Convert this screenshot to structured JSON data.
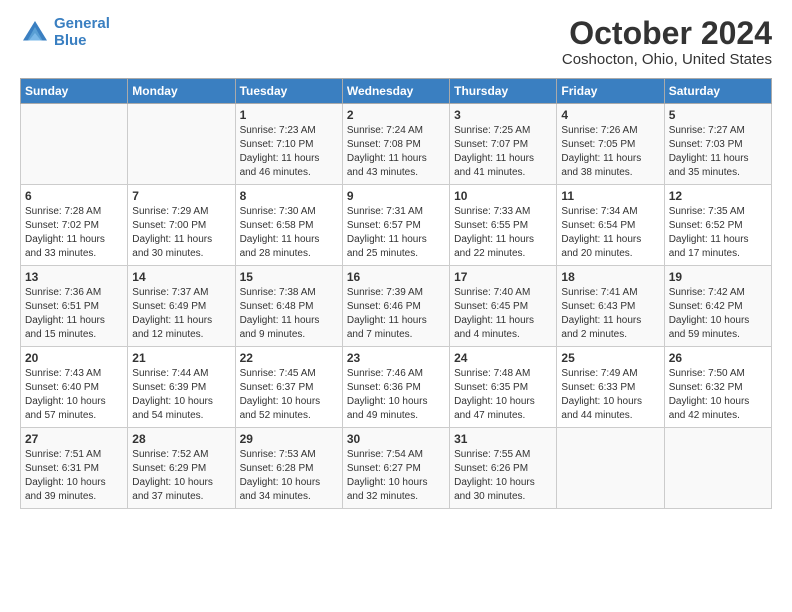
{
  "logo": {
    "line1": "General",
    "line2": "Blue"
  },
  "title": "October 2024",
  "subtitle": "Coshocton, Ohio, United States",
  "days_of_week": [
    "Sunday",
    "Monday",
    "Tuesday",
    "Wednesday",
    "Thursday",
    "Friday",
    "Saturday"
  ],
  "weeks": [
    [
      {
        "day": "",
        "content": ""
      },
      {
        "day": "",
        "content": ""
      },
      {
        "day": "1",
        "content": "Sunrise: 7:23 AM\nSunset: 7:10 PM\nDaylight: 11 hours and 46 minutes."
      },
      {
        "day": "2",
        "content": "Sunrise: 7:24 AM\nSunset: 7:08 PM\nDaylight: 11 hours and 43 minutes."
      },
      {
        "day": "3",
        "content": "Sunrise: 7:25 AM\nSunset: 7:07 PM\nDaylight: 11 hours and 41 minutes."
      },
      {
        "day": "4",
        "content": "Sunrise: 7:26 AM\nSunset: 7:05 PM\nDaylight: 11 hours and 38 minutes."
      },
      {
        "day": "5",
        "content": "Sunrise: 7:27 AM\nSunset: 7:03 PM\nDaylight: 11 hours and 35 minutes."
      }
    ],
    [
      {
        "day": "6",
        "content": "Sunrise: 7:28 AM\nSunset: 7:02 PM\nDaylight: 11 hours and 33 minutes."
      },
      {
        "day": "7",
        "content": "Sunrise: 7:29 AM\nSunset: 7:00 PM\nDaylight: 11 hours and 30 minutes."
      },
      {
        "day": "8",
        "content": "Sunrise: 7:30 AM\nSunset: 6:58 PM\nDaylight: 11 hours and 28 minutes."
      },
      {
        "day": "9",
        "content": "Sunrise: 7:31 AM\nSunset: 6:57 PM\nDaylight: 11 hours and 25 minutes."
      },
      {
        "day": "10",
        "content": "Sunrise: 7:33 AM\nSunset: 6:55 PM\nDaylight: 11 hours and 22 minutes."
      },
      {
        "day": "11",
        "content": "Sunrise: 7:34 AM\nSunset: 6:54 PM\nDaylight: 11 hours and 20 minutes."
      },
      {
        "day": "12",
        "content": "Sunrise: 7:35 AM\nSunset: 6:52 PM\nDaylight: 11 hours and 17 minutes."
      }
    ],
    [
      {
        "day": "13",
        "content": "Sunrise: 7:36 AM\nSunset: 6:51 PM\nDaylight: 11 hours and 15 minutes."
      },
      {
        "day": "14",
        "content": "Sunrise: 7:37 AM\nSunset: 6:49 PM\nDaylight: 11 hours and 12 minutes."
      },
      {
        "day": "15",
        "content": "Sunrise: 7:38 AM\nSunset: 6:48 PM\nDaylight: 11 hours and 9 minutes."
      },
      {
        "day": "16",
        "content": "Sunrise: 7:39 AM\nSunset: 6:46 PM\nDaylight: 11 hours and 7 minutes."
      },
      {
        "day": "17",
        "content": "Sunrise: 7:40 AM\nSunset: 6:45 PM\nDaylight: 11 hours and 4 minutes."
      },
      {
        "day": "18",
        "content": "Sunrise: 7:41 AM\nSunset: 6:43 PM\nDaylight: 11 hours and 2 minutes."
      },
      {
        "day": "19",
        "content": "Sunrise: 7:42 AM\nSunset: 6:42 PM\nDaylight: 10 hours and 59 minutes."
      }
    ],
    [
      {
        "day": "20",
        "content": "Sunrise: 7:43 AM\nSunset: 6:40 PM\nDaylight: 10 hours and 57 minutes."
      },
      {
        "day": "21",
        "content": "Sunrise: 7:44 AM\nSunset: 6:39 PM\nDaylight: 10 hours and 54 minutes."
      },
      {
        "day": "22",
        "content": "Sunrise: 7:45 AM\nSunset: 6:37 PM\nDaylight: 10 hours and 52 minutes."
      },
      {
        "day": "23",
        "content": "Sunrise: 7:46 AM\nSunset: 6:36 PM\nDaylight: 10 hours and 49 minutes."
      },
      {
        "day": "24",
        "content": "Sunrise: 7:48 AM\nSunset: 6:35 PM\nDaylight: 10 hours and 47 minutes."
      },
      {
        "day": "25",
        "content": "Sunrise: 7:49 AM\nSunset: 6:33 PM\nDaylight: 10 hours and 44 minutes."
      },
      {
        "day": "26",
        "content": "Sunrise: 7:50 AM\nSunset: 6:32 PM\nDaylight: 10 hours and 42 minutes."
      }
    ],
    [
      {
        "day": "27",
        "content": "Sunrise: 7:51 AM\nSunset: 6:31 PM\nDaylight: 10 hours and 39 minutes."
      },
      {
        "day": "28",
        "content": "Sunrise: 7:52 AM\nSunset: 6:29 PM\nDaylight: 10 hours and 37 minutes."
      },
      {
        "day": "29",
        "content": "Sunrise: 7:53 AM\nSunset: 6:28 PM\nDaylight: 10 hours and 34 minutes."
      },
      {
        "day": "30",
        "content": "Sunrise: 7:54 AM\nSunset: 6:27 PM\nDaylight: 10 hours and 32 minutes."
      },
      {
        "day": "31",
        "content": "Sunrise: 7:55 AM\nSunset: 6:26 PM\nDaylight: 10 hours and 30 minutes."
      },
      {
        "day": "",
        "content": ""
      },
      {
        "day": "",
        "content": ""
      }
    ]
  ]
}
